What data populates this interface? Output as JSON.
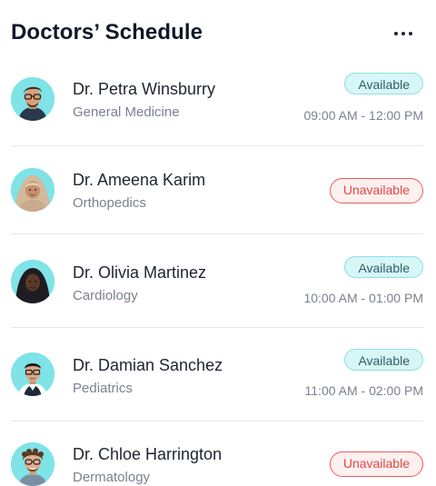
{
  "header": {
    "title": "Doctors’ Schedule",
    "more_icon": "more-horizontal-icon"
  },
  "doctors": [
    {
      "name": "Dr. Petra Winsburry",
      "specialty": "General Medicine",
      "status": "Available",
      "hours": "09:00 AM - 12:00 PM"
    },
    {
      "name": "Dr. Ameena Karim",
      "specialty": "Orthopedics",
      "status": "Unavailable",
      "hours": ""
    },
    {
      "name": "Dr. Olivia Martinez",
      "specialty": "Cardiology",
      "status": "Available",
      "hours": "10:00 AM - 01:00 PM"
    },
    {
      "name": "Dr. Damian Sanchez",
      "specialty": "Pediatrics",
      "status": "Available",
      "hours": "11:00 AM - 02:00 PM"
    },
    {
      "name": "Dr. Chloe Harrington",
      "specialty": "Dermatology",
      "status": "Unavailable",
      "hours": ""
    }
  ],
  "colors": {
    "available_bg": "#d7f6f8",
    "available_border": "#8fdfe4",
    "unavailable_text": "#e04848",
    "unavailable_border": "#ee5a5a",
    "avatar_bg": "#7fe3e8"
  }
}
